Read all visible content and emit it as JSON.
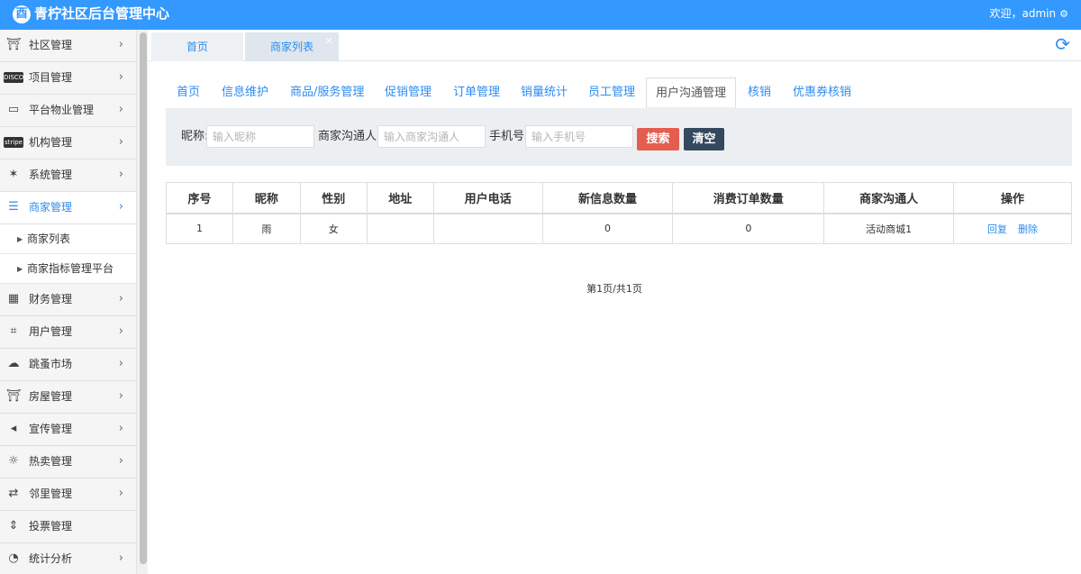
{
  "header": {
    "logo_glyph": "⾣",
    "title": "青柠社区后台管理中心",
    "welcome": "欢迎，admin",
    "gear_icon": "gear-icon"
  },
  "sidebar": {
    "items": [
      {
        "label": "社区管理",
        "icon": "bank-icon",
        "glyph": "🏛"
      },
      {
        "label": "项目管理",
        "icon": "discover-card-icon",
        "glyph": "DISCOVER"
      },
      {
        "label": "平台物业管理",
        "icon": "monitor-icon",
        "glyph": "🖥"
      },
      {
        "label": "机构管理",
        "icon": "stripe-icon",
        "glyph": "stripe"
      },
      {
        "label": "系统管理",
        "icon": "yelp-icon",
        "glyph": "✶"
      },
      {
        "label": "商家管理",
        "icon": "bars-icon",
        "glyph": "☰",
        "active": true
      },
      {
        "label": "财务管理",
        "icon": "calculator-icon",
        "glyph": "▦"
      },
      {
        "label": "用户管理",
        "icon": "crop-icon",
        "glyph": "⌗"
      },
      {
        "label": "跳蚤市场",
        "icon": "cloud-icon",
        "glyph": "☁"
      },
      {
        "label": "房屋管理",
        "icon": "bank-icon",
        "glyph": "🏛"
      },
      {
        "label": "宣传管理",
        "icon": "volume-icon",
        "glyph": "◂"
      },
      {
        "label": "热卖管理",
        "icon": "sun-icon",
        "glyph": "☼"
      },
      {
        "label": "邻里管理",
        "icon": "retweet-icon",
        "glyph": "⇄"
      },
      {
        "label": "投票管理",
        "icon": "sort-icon",
        "glyph": "⇕"
      },
      {
        "label": "统计分析",
        "icon": "pie-chart-icon",
        "glyph": "◔"
      }
    ],
    "subitems": [
      {
        "label": "商家列表"
      },
      {
        "label": "商家指标管理平台"
      }
    ]
  },
  "page_tabs": [
    {
      "label": "首页"
    },
    {
      "label": "商家列表",
      "closable": true
    }
  ],
  "subnav": [
    {
      "label": "首页"
    },
    {
      "label": "信息维护"
    },
    {
      "label": "商品/服务管理"
    },
    {
      "label": "促销管理"
    },
    {
      "label": "订单管理"
    },
    {
      "label": "销量统计"
    },
    {
      "label": "员工管理"
    },
    {
      "label": "用户沟通管理",
      "active": true
    },
    {
      "label": "核销"
    },
    {
      "label": "优惠券核销"
    }
  ],
  "search": {
    "nickname_label": "昵称:",
    "nickname_placeholder": "输入昵称",
    "contact_label": "商家沟通人:",
    "contact_placeholder": "输入商家沟通人",
    "phone_label": "手机号:",
    "phone_placeholder": "输入手机号",
    "search_button": "搜索",
    "clear_button": "清空"
  },
  "table": {
    "columns": [
      "序号",
      "昵称",
      "性别",
      "地址",
      "用户电话",
      "新信息数量",
      "消费订单数量",
      "商家沟通人",
      "操作"
    ],
    "rows": [
      {
        "index": "1",
        "nickname": "雨",
        "gender": "女",
        "address": "",
        "phone": "",
        "new_messages": "0",
        "orders": "0",
        "contact": "活动商城1",
        "reply": "回复",
        "delete": "删除"
      }
    ]
  },
  "pager": {
    "text": "第1页/共1页"
  },
  "colors": {
    "accent": "#3399ff",
    "link": "#2d8cf0",
    "search_button": "#e55d4f",
    "clear_button": "#34495e"
  }
}
